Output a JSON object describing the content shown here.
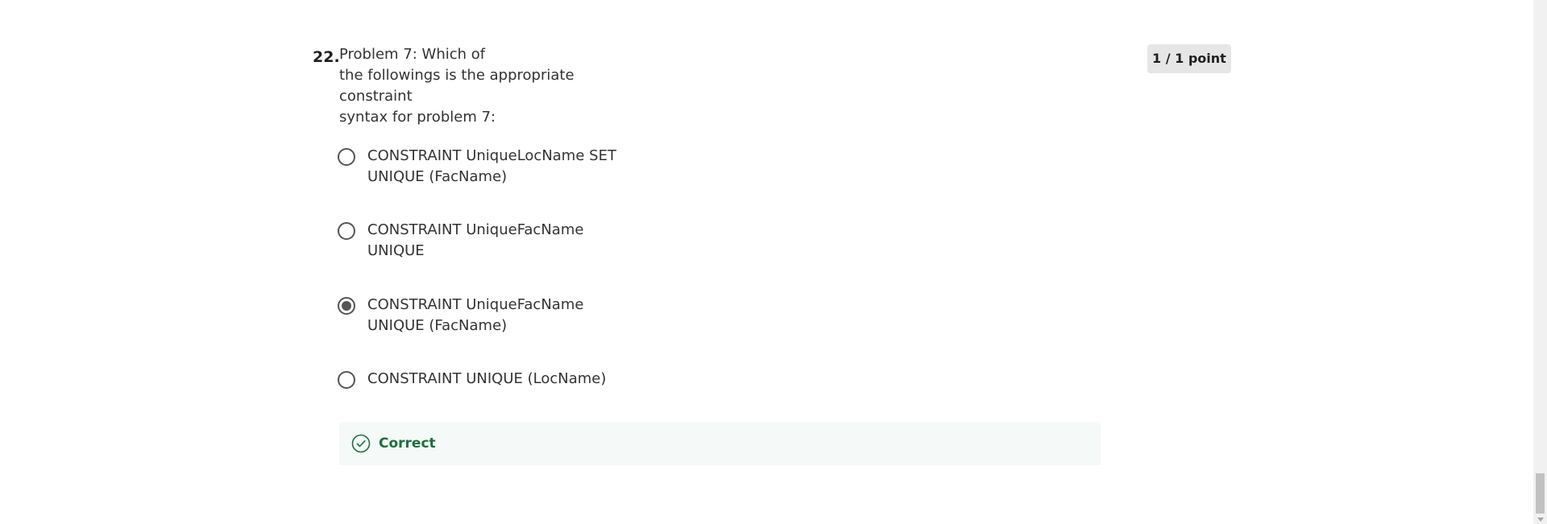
{
  "question": {
    "number": "22.",
    "prompt_lines": [
      "Problem 7: Which of",
      "the followings is the appropriate constraint",
      "syntax for problem 7:"
    ],
    "points": "1 / 1 point"
  },
  "options": [
    {
      "lines": [
        "CONSTRAINT UniqueLocName SET",
        "UNIQUE (FacName)"
      ],
      "selected": false
    },
    {
      "lines": [
        "CONSTRAINT UniqueFacName",
        "UNIQUE"
      ],
      "selected": false
    },
    {
      "lines": [
        "CONSTRAINT UniqueFacName",
        "UNIQUE (FacName)"
      ],
      "selected": true
    },
    {
      "lines": [
        "CONSTRAINT UNIQUE (LocName)"
      ],
      "selected": false
    }
  ],
  "feedback": {
    "label": "Correct",
    "icon": "check-circle-icon",
    "color": "#1e6e3f"
  }
}
